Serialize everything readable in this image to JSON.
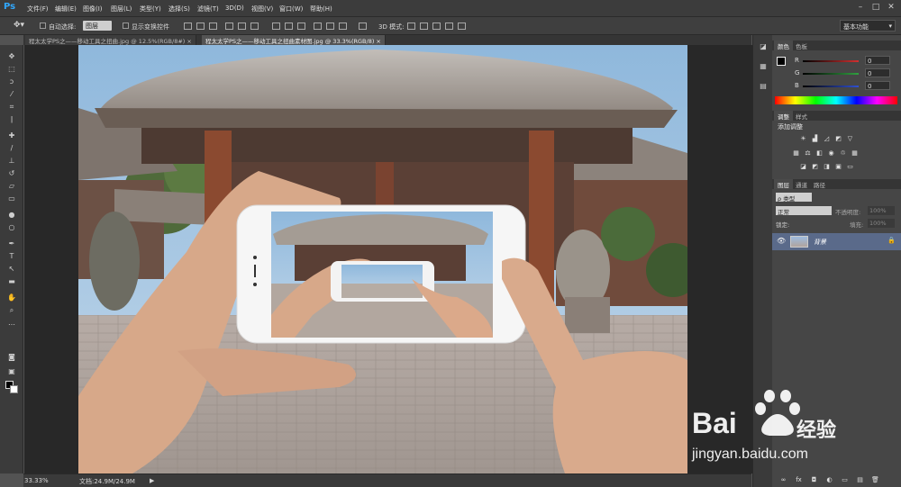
{
  "app": {
    "logo": "Ps"
  },
  "menu": [
    "文件(F)",
    "编辑(E)",
    "图像(I)",
    "图层(L)",
    "类型(Y)",
    "选择(S)",
    "滤镜(T)",
    "3D(D)",
    "视图(V)",
    "窗口(W)",
    "帮助(H)"
  ],
  "window_buttons": [
    "–",
    "□",
    "✕"
  ],
  "options": {
    "auto_select_label": "自动选择:",
    "auto_select_value": "图层",
    "show_transform_label": "显示变换控件",
    "mode_3d_label": "3D 模式:",
    "workspace": "基本功能"
  },
  "tabs": [
    {
      "label": "程太太学PS之——移动工具之扭曲.jpg @ 12.5%(RGB/8#) ×",
      "active": false
    },
    {
      "label": "程太太学PS之——移动工具之扭曲素材图.jpg @ 33.3%(RGB/8) ×",
      "active": true
    }
  ],
  "status": {
    "zoom": "33.33%",
    "doc": "文档:24.9M/24.9M"
  },
  "panels": {
    "color_tabs": [
      "颜色",
      "色板"
    ],
    "sliders": [
      {
        "label": "R",
        "value": "0",
        "color": "#d23030"
      },
      {
        "label": "G",
        "value": "0",
        "color": "#30a040"
      },
      {
        "label": "B",
        "value": "0",
        "color": "#3050d0"
      }
    ],
    "adjust_tabs": [
      "调整",
      "样式"
    ],
    "adjust_title": "添加调整",
    "layers_tabs": [
      "图层",
      "通道",
      "路径"
    ],
    "kind_label": "ρ 类型",
    "blend_mode": "正常",
    "opacity_label": "不透明度:",
    "opacity_value": "100%",
    "lock_label": "锁定:",
    "fill_label": "填充:",
    "fill_value": "100%",
    "layer_name": "背景"
  },
  "watermark": {
    "brand": "Bai",
    "brand_cn": "经验",
    "url": "jingyan.baidu.com"
  }
}
